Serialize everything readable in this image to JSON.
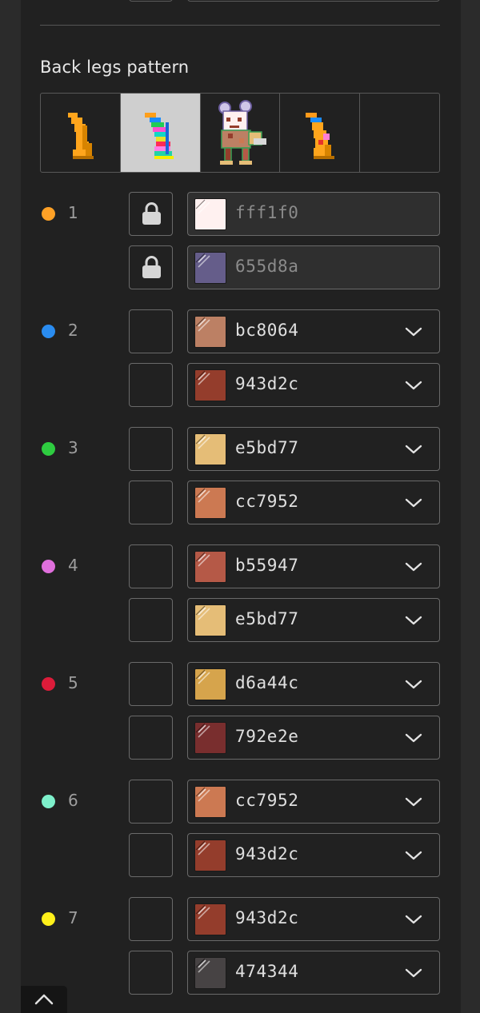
{
  "section": {
    "title": "Back legs pattern"
  },
  "patterns": [
    {
      "name": "Orange crescent leg",
      "selected": false
    },
    {
      "name": "Rainbow striped leg",
      "selected": true
    },
    {
      "name": "Spotted pony preview",
      "selected": false
    },
    {
      "name": "Orange leg with red patch",
      "selected": false
    },
    {
      "name": "Empty option",
      "selected": false
    }
  ],
  "colors": {
    "accent_lock": "#d0d0d0",
    "panel": "#212121",
    "border": "#6a6a6a"
  },
  "slots": [
    {
      "number": "1",
      "dot_color": "#ffa126",
      "rows": [
        {
          "hex": "fff1f0",
          "swatch": "#fff1f0",
          "locked": true
        },
        {
          "hex": "655d8a",
          "swatch": "#655d8a",
          "locked": true
        }
      ]
    },
    {
      "number": "2",
      "dot_color": "#2a8cf0",
      "rows": [
        {
          "hex": "bc8064",
          "swatch": "#bc8064",
          "locked": false
        },
        {
          "hex": "943d2c",
          "swatch": "#943d2c",
          "locked": false
        }
      ]
    },
    {
      "number": "3",
      "dot_color": "#2ecc40",
      "rows": [
        {
          "hex": "e5bd77",
          "swatch": "#e5bd77",
          "locked": false
        },
        {
          "hex": "cc7952",
          "swatch": "#cc7952",
          "locked": false
        }
      ]
    },
    {
      "number": "4",
      "dot_color": "#df6fdc",
      "rows": [
        {
          "hex": "b55947",
          "swatch": "#b55947",
          "locked": false
        },
        {
          "hex": "e5bd77",
          "swatch": "#e5bd77",
          "locked": false
        }
      ]
    },
    {
      "number": "5",
      "dot_color": "#dc1c3a",
      "rows": [
        {
          "hex": "d6a44c",
          "swatch": "#d6a44c",
          "locked": false
        },
        {
          "hex": "792e2e",
          "swatch": "#792e2e",
          "locked": false
        }
      ]
    },
    {
      "number": "6",
      "dot_color": "#7ef0cb",
      "rows": [
        {
          "hex": "cc7952",
          "swatch": "#cc7952",
          "locked": false
        },
        {
          "hex": "943d2c",
          "swatch": "#943d2c",
          "locked": false
        }
      ]
    },
    {
      "number": "7",
      "dot_color": "#fff01a",
      "rows": [
        {
          "hex": "943d2c",
          "swatch": "#943d2c",
          "locked": false
        },
        {
          "hex": "474344",
          "swatch": "#474344",
          "locked": false
        }
      ]
    }
  ],
  "icons": {
    "lock": "lock-icon",
    "chevron": "chevron-down-icon",
    "scroll_top": "chevron-up-icon"
  }
}
